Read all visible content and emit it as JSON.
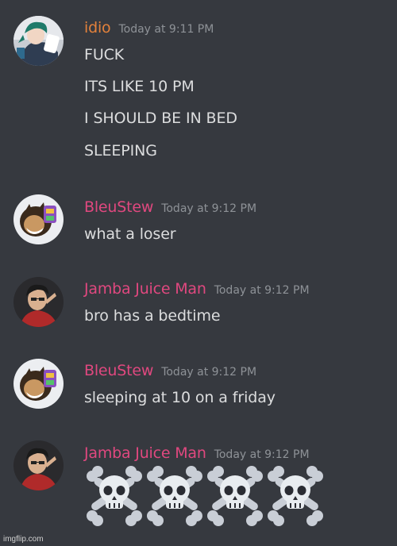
{
  "colors": {
    "background": "#36393f",
    "message_text": "#dcddde",
    "timestamp": "#8e9297",
    "idio": "#e3813b",
    "bleustew": "#e0487f",
    "jamba": "#e0487f"
  },
  "messages": [
    {
      "username": "idio",
      "timestamp": "Today at 9:11 PM",
      "avatar": "idio-avatar",
      "lines": [
        "FUCK",
        "ITS LIKE 10 PM",
        "I SHOULD BE IN BED",
        "SLEEPING"
      ]
    },
    {
      "username": "BleuStew",
      "timestamp": "Today at 9:12 PM",
      "avatar": "bleustew-avatar",
      "lines": [
        "what a loser"
      ]
    },
    {
      "username": "Jamba Juice Man",
      "timestamp": "Today at 9:12 PM",
      "avatar": "jamba-avatar",
      "lines": [
        "bro has a bedtime"
      ]
    },
    {
      "username": "BleuStew",
      "timestamp": "Today at 9:12 PM",
      "avatar": "bleustew-avatar",
      "lines": [
        "sleeping at 10 on a friday"
      ]
    },
    {
      "username": "Jamba Juice Man",
      "timestamp": "Today at 9:12 PM",
      "avatar": "jamba-avatar",
      "emojis": [
        "skull-and-crossbones",
        "skull-and-crossbones",
        "skull-and-crossbones",
        "skull-and-crossbones"
      ]
    }
  ],
  "watermark": "imgflip.com"
}
